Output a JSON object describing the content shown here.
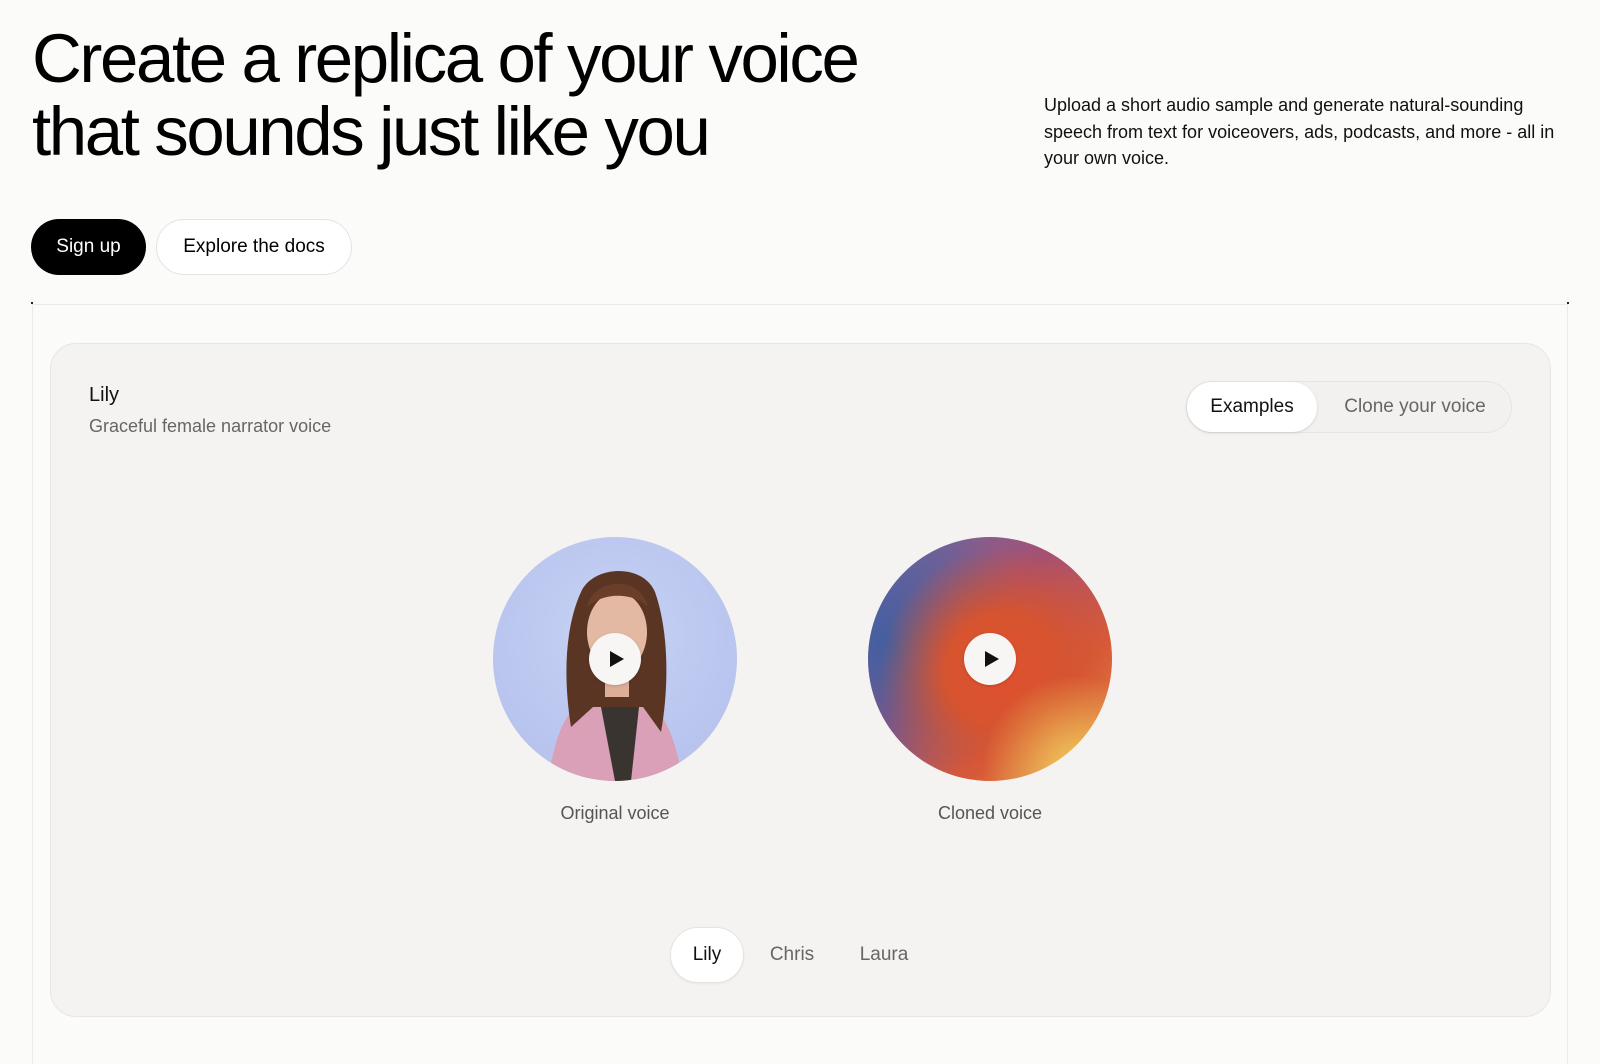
{
  "hero": {
    "title_line1": "Create a replica of your voice",
    "title_line2": "that sounds just like you",
    "description": "Upload a short audio sample and generate natural-sounding speech from text for voiceovers, ads, podcasts, and more - all in your own voice."
  },
  "cta": {
    "primary_label": "Sign up",
    "secondary_label": "Explore the docs"
  },
  "demo": {
    "voice_name": "Lily",
    "voice_description": "Graceful female narrator voice",
    "mode_tabs": [
      {
        "label": "Examples",
        "selected": true
      },
      {
        "label": "Clone your voice",
        "selected": false
      }
    ],
    "original": {
      "caption": "Original voice",
      "icon": "play-icon"
    },
    "cloned": {
      "caption": "Cloned voice",
      "icon": "play-icon"
    },
    "voices": [
      {
        "label": "Lily",
        "selected": true
      },
      {
        "label": "Chris",
        "selected": false
      },
      {
        "label": "Laura",
        "selected": false
      }
    ]
  },
  "colors": {
    "primary_button": "#000000",
    "card_background": "#f5f3f1",
    "original_avatar_bg": "#bac6ef",
    "cloned_orb_core": "#d6542f"
  }
}
